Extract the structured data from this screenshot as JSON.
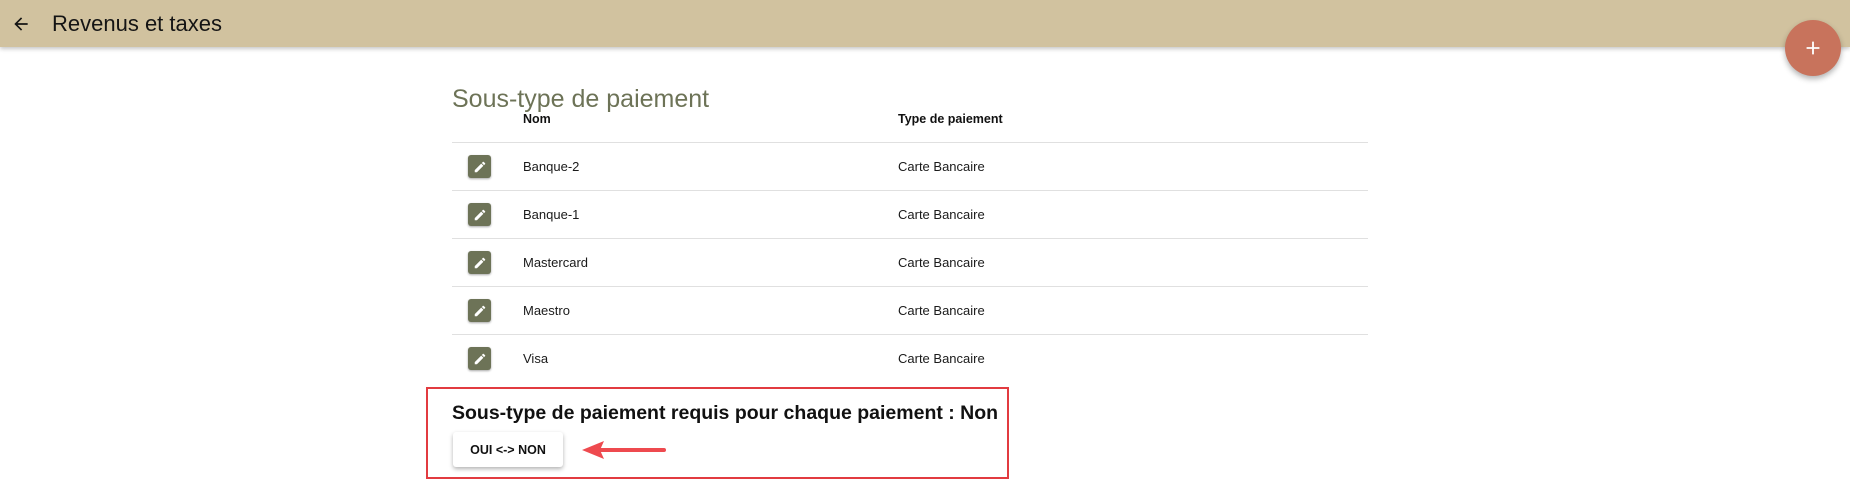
{
  "app_bar": {
    "title": "Revenus et taxes",
    "back_icon": "arrow-back-icon",
    "color": "#d1c29f"
  },
  "fab": {
    "icon": "plus-icon",
    "color": "#c8735c"
  },
  "section": {
    "title": "Sous-type de paiement",
    "columns": [
      "Nom",
      "Type de paiement"
    ],
    "rows": [
      {
        "nom": "Banque-2",
        "type": "Carte Bancaire"
      },
      {
        "nom": "Banque-1",
        "type": "Carte Bancaire"
      },
      {
        "nom": "Mastercard",
        "type": "Carte Bancaire"
      },
      {
        "nom": "Maestro",
        "type": "Carte Bancaire"
      },
      {
        "nom": "Visa",
        "type": "Carte Bancaire"
      }
    ],
    "edit_icon": "pencil-icon",
    "accent_color": "#6d7357"
  },
  "requirement": {
    "text": "Sous-type de paiement requis pour chaque paiement : Non",
    "toggle_label": "OUI <-> NON",
    "highlight_color": "#e23b40",
    "annotation_icon": "red-arrow-left-icon"
  }
}
